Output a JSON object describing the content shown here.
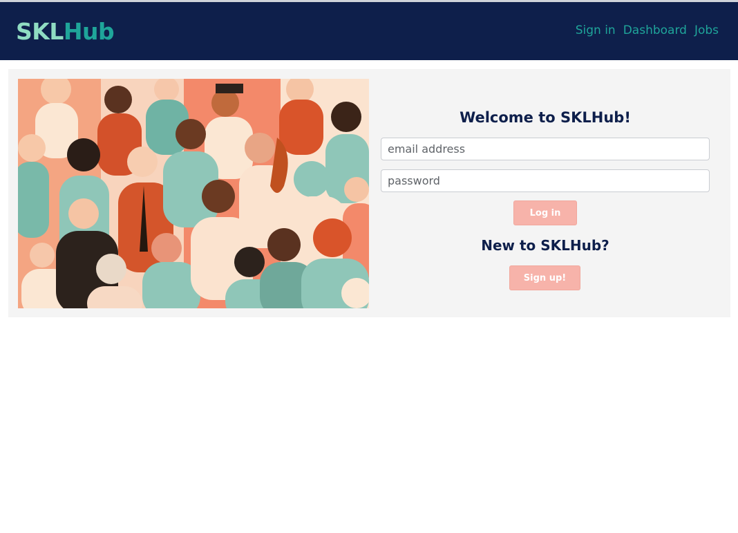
{
  "navbar": {
    "brand_part1": "SKL",
    "brand_part2": "Hub",
    "links": [
      "Sign in",
      "Dashboard",
      "Jobs"
    ]
  },
  "hero": {
    "image_icon": "crowd-illustration"
  },
  "login": {
    "heading": "Welcome to SKLHub!",
    "email_placeholder": "email address",
    "password_placeholder": "password",
    "login_label": "Log in"
  },
  "signup": {
    "heading": "New to SKLHub?",
    "signup_label": "Sign up!"
  },
  "colors": {
    "navbar_bg": "#0e1f4b",
    "brand_light": "#8fdcc2",
    "brand_teal": "#1fa59a",
    "button_bg": "#f7b3aa",
    "card_bg": "#f4f4f4"
  }
}
